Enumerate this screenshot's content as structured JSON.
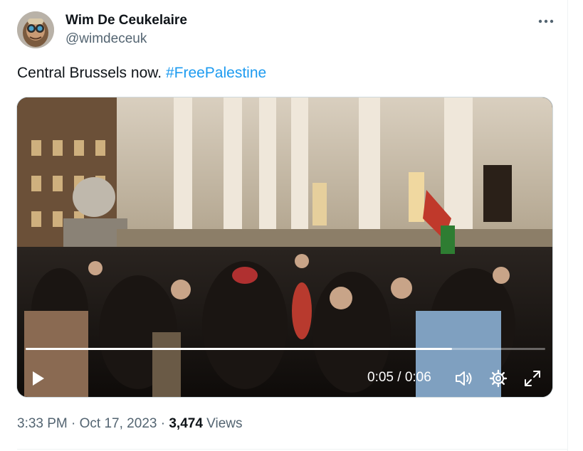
{
  "author": {
    "display_name": "Wim De Ceukelaire",
    "handle": "@wimdeceuk"
  },
  "tweet": {
    "text": "Central Brussels now.",
    "hashtag": "#FreePalestine"
  },
  "video": {
    "current_time": "0:05",
    "separator": "/",
    "duration": "0:06",
    "progress_fraction": 0.82
  },
  "meta": {
    "time": "3:33 PM",
    "dot1": "·",
    "date": "Oct 17, 2023",
    "dot2": "·",
    "views_count": "3,474",
    "views_label": "Views"
  },
  "colors": {
    "link": "#1d9bf0",
    "secondary_text": "#536471",
    "primary_text": "#0f1419"
  },
  "icons": {
    "more": "more-horizontal-icon",
    "play": "play-icon",
    "volume": "volume-icon",
    "settings": "gear-icon",
    "fullscreen": "fullscreen-icon"
  }
}
